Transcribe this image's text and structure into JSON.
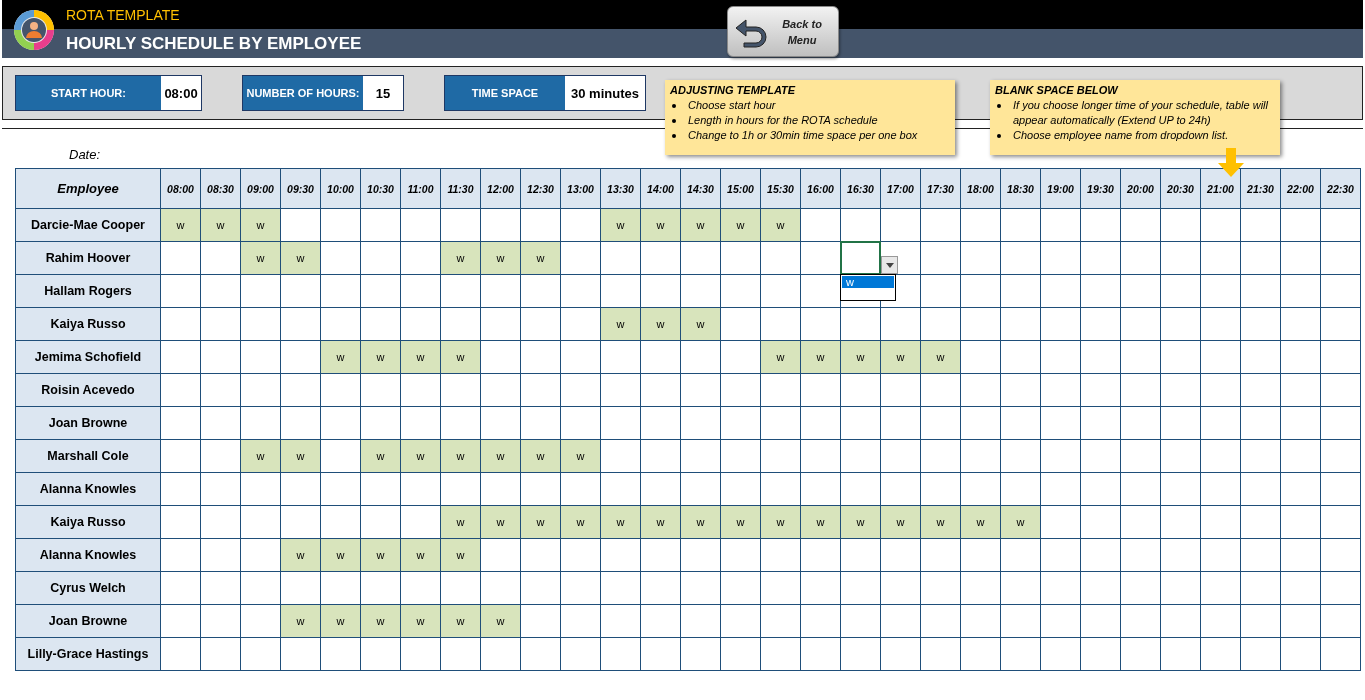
{
  "header": {
    "subtitle": "ROTA TEMPLATE",
    "title": "HOURLY SCHEDULE BY EMPLOYEE",
    "back_button": "Back to Menu"
  },
  "settings": [
    {
      "label": "START HOUR:",
      "value": "08:00"
    },
    {
      "label": "NUMBER OF HOURS:",
      "value": "15"
    },
    {
      "label": "TIME SPACE",
      "value": "30 minutes"
    }
  ],
  "notes": [
    {
      "title": "ADJUSTING TEMPLATE",
      "items": [
        "Choose start hour",
        "Length in hours for the ROTA schedule",
        "Change to 1h or 30min time space per one box"
      ]
    },
    {
      "title": "BLANK SPACE BELOW",
      "items": [
        "If you choose longer time of your schedule, table will appear automatically (Extend UP to 24h)",
        "Choose employee name from dropdown list."
      ]
    }
  ],
  "date_label": "Date:",
  "table": {
    "employee_header": "Employee",
    "times": [
      "08:00",
      "08:30",
      "09:00",
      "09:30",
      "10:00",
      "10:30",
      "11:00",
      "11:30",
      "12:00",
      "12:30",
      "13:00",
      "13:30",
      "14:00",
      "14:30",
      "15:00",
      "15:30",
      "16:00",
      "16:30",
      "17:00",
      "17:30",
      "18:00",
      "18:30",
      "19:00",
      "19:30",
      "20:00",
      "20:30",
      "21:00",
      "21:30",
      "22:00",
      "22:30"
    ],
    "rows": [
      {
        "name": "Darcie-Mae Cooper",
        "cells": [
          {
            "text": "w"
          },
          {
            "text": "w"
          },
          {
            "text": "w"
          },
          null,
          null,
          null,
          null,
          null,
          null,
          null,
          null,
          {
            "text": "w"
          },
          {
            "text": "w"
          },
          {
            "text": "w"
          },
          {
            "text": "w"
          },
          {
            "text": "w"
          },
          null,
          null,
          null,
          null,
          null,
          null,
          null,
          null,
          null,
          null,
          null,
          null,
          null,
          null
        ]
      },
      {
        "name": "Rahim Hoover",
        "cells": [
          null,
          null,
          {
            "text": "w"
          },
          {
            "text": "w"
          },
          null,
          null,
          null,
          {
            "text": "w"
          },
          {
            "text": "w"
          },
          {
            "text": "w"
          },
          null,
          null,
          null,
          null,
          null,
          null,
          null,
          {
            "active": true,
            "options": [
              {
                "label": "w",
                "selected": true
              }
            ]
          },
          null,
          null,
          null,
          null,
          null,
          null,
          null,
          null,
          null,
          null,
          null,
          null
        ]
      },
      {
        "name": "Hallam Rogers",
        "cells": [
          null,
          null,
          null,
          null,
          null,
          null,
          null,
          null,
          null,
          null,
          null,
          null,
          null,
          null,
          null,
          null,
          null,
          null,
          null,
          null,
          null,
          null,
          null,
          null,
          null,
          null,
          null,
          null,
          null,
          null
        ]
      },
      {
        "name": "Kaiya Russo",
        "cells": [
          null,
          null,
          null,
          null,
          null,
          null,
          null,
          null,
          null,
          null,
          null,
          {
            "text": "w"
          },
          {
            "text": "w"
          },
          {
            "text": "w"
          },
          null,
          null,
          null,
          null,
          null,
          null,
          null,
          null,
          null,
          null,
          null,
          null,
          null,
          null,
          null,
          null
        ]
      },
      {
        "name": "Jemima Schofield",
        "cells": [
          null,
          null,
          null,
          null,
          {
            "text": "w"
          },
          {
            "text": "w"
          },
          {
            "text": "w"
          },
          {
            "text": "w"
          },
          null,
          null,
          null,
          null,
          null,
          null,
          null,
          {
            "text": "w"
          },
          {
            "text": "w"
          },
          {
            "text": "w"
          },
          {
            "text": "w"
          },
          {
            "text": "w"
          },
          null,
          null,
          null,
          null,
          null,
          null,
          null,
          null,
          null,
          null
        ]
      },
      {
        "name": "Roisin Acevedo",
        "cells": [
          null,
          null,
          null,
          null,
          null,
          null,
          null,
          null,
          null,
          null,
          null,
          null,
          null,
          null,
          null,
          null,
          null,
          null,
          null,
          null,
          null,
          null,
          null,
          null,
          null,
          null,
          null,
          null,
          null,
          null
        ]
      },
      {
        "name": "Joan Browne",
        "cells": [
          null,
          null,
          null,
          null,
          null,
          null,
          null,
          null,
          null,
          null,
          null,
          null,
          null,
          null,
          null,
          null,
          null,
          null,
          null,
          null,
          null,
          null,
          null,
          null,
          null,
          null,
          null,
          null,
          null,
          null
        ]
      },
      {
        "name": "Marshall Cole",
        "cells": [
          null,
          null,
          {
            "text": "w"
          },
          {
            "text": "w"
          },
          null,
          {
            "text": "w"
          },
          {
            "text": "w"
          },
          {
            "text": "w"
          },
          {
            "text": "w"
          },
          {
            "text": "w"
          },
          {
            "text": "w"
          },
          null,
          null,
          null,
          null,
          null,
          null,
          null,
          null,
          null,
          null,
          null,
          null,
          null,
          null,
          null,
          null,
          null,
          null,
          null
        ]
      },
      {
        "name": "Alanna Knowles",
        "cells": [
          null,
          null,
          null,
          null,
          null,
          null,
          null,
          null,
          null,
          null,
          null,
          null,
          null,
          null,
          null,
          null,
          null,
          null,
          null,
          null,
          null,
          null,
          null,
          null,
          null,
          null,
          null,
          null,
          null,
          null
        ]
      },
      {
        "name": "Kaiya Russo",
        "cells": [
          null,
          null,
          null,
          null,
          null,
          null,
          null,
          {
            "text": "w"
          },
          {
            "text": "w"
          },
          {
            "text": "w"
          },
          {
            "text": "w"
          },
          {
            "text": "w"
          },
          {
            "text": "w"
          },
          {
            "text": "w"
          },
          {
            "text": "w"
          },
          {
            "text": "w"
          },
          {
            "text": "w"
          },
          {
            "text": "w"
          },
          {
            "text": "w"
          },
          {
            "text": "w"
          },
          {
            "text": "w"
          },
          {
            "text": "w"
          },
          null,
          null,
          null,
          null,
          null,
          null,
          null,
          null
        ]
      },
      {
        "name": "Alanna Knowles",
        "cells": [
          null,
          null,
          null,
          {
            "text": "w"
          },
          {
            "text": "w"
          },
          {
            "text": "w"
          },
          {
            "text": "w"
          },
          {
            "text": "w"
          },
          null,
          null,
          null,
          null,
          null,
          null,
          null,
          null,
          null,
          null,
          null,
          null,
          null,
          null,
          null,
          null,
          null,
          null,
          null,
          null,
          null,
          null
        ]
      },
      {
        "name": "Cyrus Welch",
        "cells": [
          null,
          null,
          null,
          null,
          null,
          null,
          null,
          null,
          null,
          null,
          null,
          null,
          null,
          null,
          null,
          null,
          null,
          null,
          null,
          null,
          null,
          null,
          null,
          null,
          null,
          null,
          null,
          null,
          null,
          null
        ]
      },
      {
        "name": "Joan Browne",
        "cells": [
          null,
          null,
          null,
          {
            "text": "w"
          },
          {
            "text": "w"
          },
          {
            "text": "w"
          },
          {
            "text": "w"
          },
          {
            "text": "w"
          },
          {
            "text": "w"
          },
          null,
          null,
          null,
          null,
          null,
          null,
          null,
          null,
          null,
          null,
          null,
          null,
          null,
          null,
          null,
          null,
          null,
          null,
          null,
          null,
          null
        ]
      },
      {
        "name": "Lilly-Grace Hastings",
        "cells": [
          null,
          null,
          null,
          null,
          null,
          null,
          null,
          null,
          null,
          null,
          null,
          null,
          null,
          null,
          null,
          null,
          null,
          null,
          null,
          null,
          null,
          null,
          null,
          null,
          null,
          null,
          null,
          null,
          null,
          null
        ]
      }
    ]
  }
}
